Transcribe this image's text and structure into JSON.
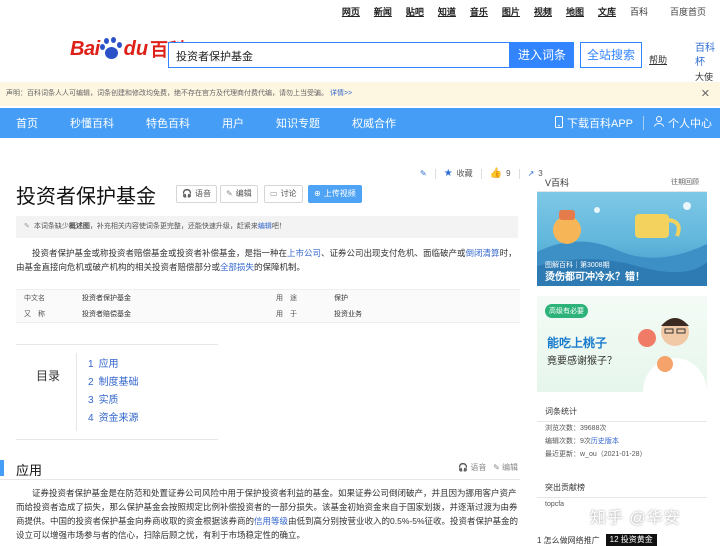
{
  "toplinks": [
    "网页",
    "新闻",
    "贴吧",
    "知道",
    "音乐",
    "图片",
    "视频",
    "地图",
    "文库"
  ],
  "toplink_baike": "百科",
  "toplink_home": "百度首页",
  "logo": {
    "bai": "Bai",
    "du": "du",
    "baike": "百科"
  },
  "search": {
    "value": "投资者保护基金",
    "enter_label": "进入词条",
    "all_label": "全站搜索",
    "help": "帮助"
  },
  "header_right": {
    "l1": "百科杯",
    "l2": "大使招"
  },
  "notice": {
    "text": "声明：百科词条人人可编辑，词条创建和修改均免费，绝不存在官方及代理商付费代编，请勿上当受骗。",
    "more": "详情>>",
    "close": "✕"
  },
  "nav": {
    "items": [
      "首页",
      "秒懂百科",
      "特色百科",
      "用户",
      "知识专题",
      "权威合作"
    ],
    "download": "下载百科APP",
    "personal": "个人中心"
  },
  "tools": {
    "collect": "收藏",
    "likes": "9",
    "shares": "3"
  },
  "title": "投资者保护基金",
  "title_buttons": {
    "voice": "语音",
    "edit": "编辑",
    "discuss": "讨论",
    "upload": "上传视频"
  },
  "lowinfo": {
    "pre": "本词条缺少",
    "bold": "概述图",
    "mid": "，补充相关内容使词条更完整，还能快速升级，赶紧来",
    "link": "编辑",
    "post": "吧！"
  },
  "summary": {
    "p1": "投资者保护基金或称投资者赔偿基金或投资者补偿基金，是指一种在",
    "l1": "上市公司",
    "p2": "、证券公司出现支付危机、面临破产或",
    "l2": "倒闭清算",
    "p3": "时，由基金直接向危机或破产机构的相关投资者赔偿部分或",
    "l3": "全部损失",
    "p4": "的保障机制。"
  },
  "infobox": [
    {
      "k1": "中文名",
      "v1": "投资者保护基金",
      "k2": "用　途",
      "v2": "保护"
    },
    {
      "k1": "又　称",
      "v1": "投资者赔偿基金",
      "k2": "用　于",
      "v2": "投资业务"
    }
  ],
  "toc": {
    "label": "目录",
    "items": [
      {
        "n": "1",
        "t": "应用"
      },
      {
        "n": "2",
        "t": "制度基础"
      },
      {
        "n": "3",
        "t": "实质"
      },
      {
        "n": "4",
        "t": "资金来源"
      }
    ]
  },
  "section": {
    "title": "应用",
    "voice": "语音",
    "edit": "编辑",
    "p1": "证券投资者保护基金是在防范和处置证券公司风险中用于保护投资者利益的基金。如果证券公司倒闭破产，并且因为挪用客户资产而给投资者造成了损失，那么保护基金会按照规定比例补偿投资者的一部分损失。该基金初始资金来自于国家划拨，并逐渐过渡为由券商提供。中国的投资者保护基金向券商收取的资金根据该券商的",
    "l1": "信用等级",
    "p2": "由低到高分别按营业收入的0.5%-5%征收。投资者保护基金的设立可以增强市场参与者的信心，扫除后顾之忧，有利于市场稳定性的确立。"
  },
  "vbaike": {
    "title": "V百科",
    "more": "往期回顾"
  },
  "card1": {
    "tag": "图解百科｜第3008期",
    "caption": "烫伤都可冲冷水？错！"
  },
  "card2": {
    "badge": "高级有必要",
    "line1": "能吃上桃子",
    "line2": "竟要感谢猴子？"
  },
  "stats": {
    "title": "词条统计",
    "views": "浏览次数：39688次",
    "edits_pre": "编辑次数：9次",
    "edits_link": "历史版本",
    "updated": "最近更新：w_ou（2021-01-28）"
  },
  "contrib": {
    "title": "突出贡献榜",
    "user": "topcfa"
  },
  "watermark": "知乎 @华安",
  "bottom_ad": {
    "left": "1 怎么做网络推广",
    "right": "12 投资黄金"
  },
  "colors": {
    "accent": "#459df5",
    "link": "#3366cc",
    "brand_red": "#de2118",
    "search_blue": "#3385ff"
  }
}
